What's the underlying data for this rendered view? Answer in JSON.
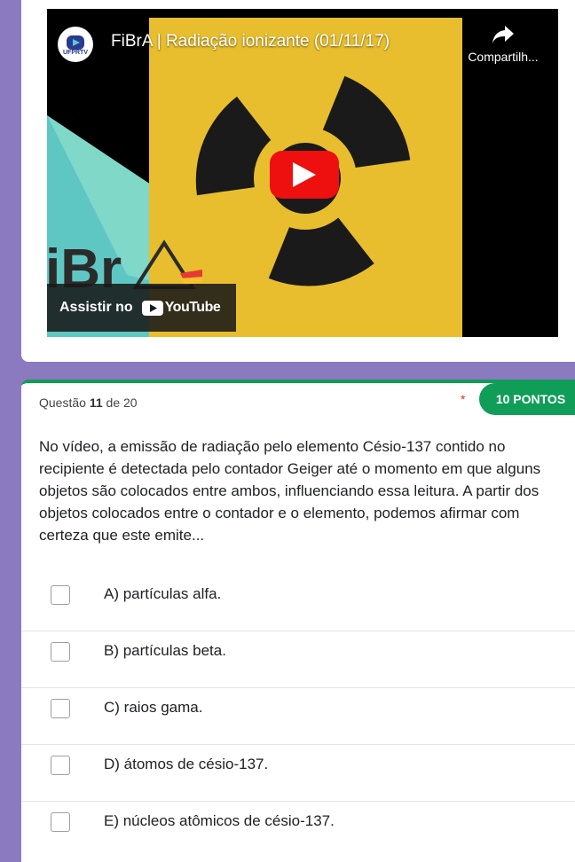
{
  "video": {
    "title": "FiBrA | Radiação ionizante (01/11/17)",
    "channel_tag": "UFPRTV",
    "share_label": "Compartilh...",
    "watch_on_label": "Assistir no",
    "youtube_label": "YouTube",
    "logo_text": "iBr",
    "colors": {
      "yellow": "#e8be2e",
      "teal": "#5ec7c3",
      "play": "#ee0f0f"
    }
  },
  "question": {
    "number_prefix": "Questão",
    "number": "11",
    "number_suffix": "de 20",
    "required_mark": "*",
    "points": "10 PONTOS",
    "text": "No vídeo, a emissão de radiação pelo elemento Césio-137 contido no recipiente é detectada pelo contador Geiger até o momento em que alguns objetos são colocados entre ambos, influenciando essa leitura. A partir dos objetos colocados entre o contador e o elemento, podemos afirmar com certeza que este emite...",
    "options": [
      {
        "label": "A) partículas alfa."
      },
      {
        "label": "B) partículas beta."
      },
      {
        "label": "C) raios gama."
      },
      {
        "label": "D) átomos de césio-137."
      },
      {
        "label": "E) núcleos atômicos de césio-137."
      }
    ],
    "accent_color": "#0f9d58"
  }
}
